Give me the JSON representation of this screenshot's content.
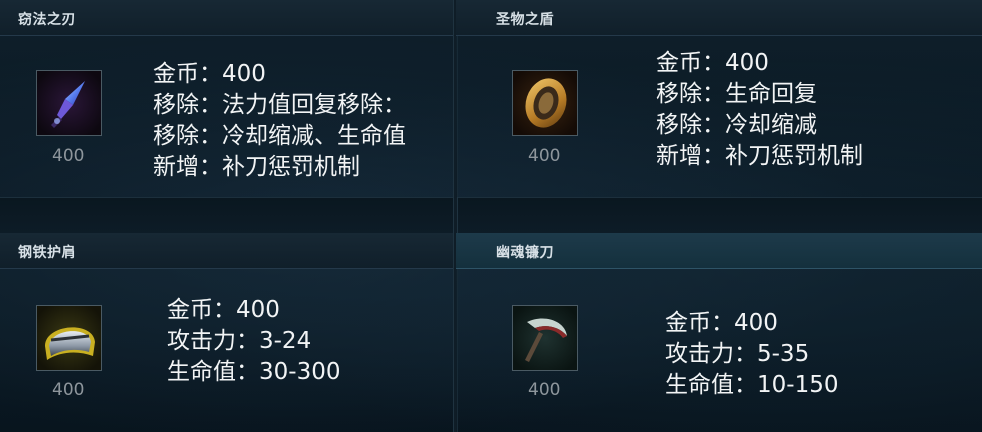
{
  "items": [
    {
      "title": "窃法之刃",
      "price": "400",
      "lines": [
        "金币：400",
        "移除：法力值回复移除：",
        "移除：冷却缩减、生命值",
        "新增：补刀惩罚机制"
      ],
      "icon": "dagger-icon"
    },
    {
      "title": "圣物之盾",
      "price": "400",
      "lines": [
        "金币：400",
        "移除：生命回复",
        "移除：冷却缩减",
        "新增：补刀惩罚机制"
      ],
      "icon": "shield-icon"
    },
    {
      "title": "钢铁护肩",
      "price": "400",
      "lines": [
        "金币：400",
        "攻击力：3-24",
        "生命值：30-300"
      ],
      "icon": "pauldron-icon"
    },
    {
      "title": "幽魂镰刀",
      "price": "400",
      "lines": [
        "金币：400",
        "攻击力：5-35",
        "生命值：10-150"
      ],
      "icon": "scythe-icon"
    }
  ],
  "colors": {
    "background": "#061018",
    "header": "#172834",
    "header_active": "#1d3a4a",
    "text": "#f2f4f5",
    "price": "#8e969c"
  }
}
